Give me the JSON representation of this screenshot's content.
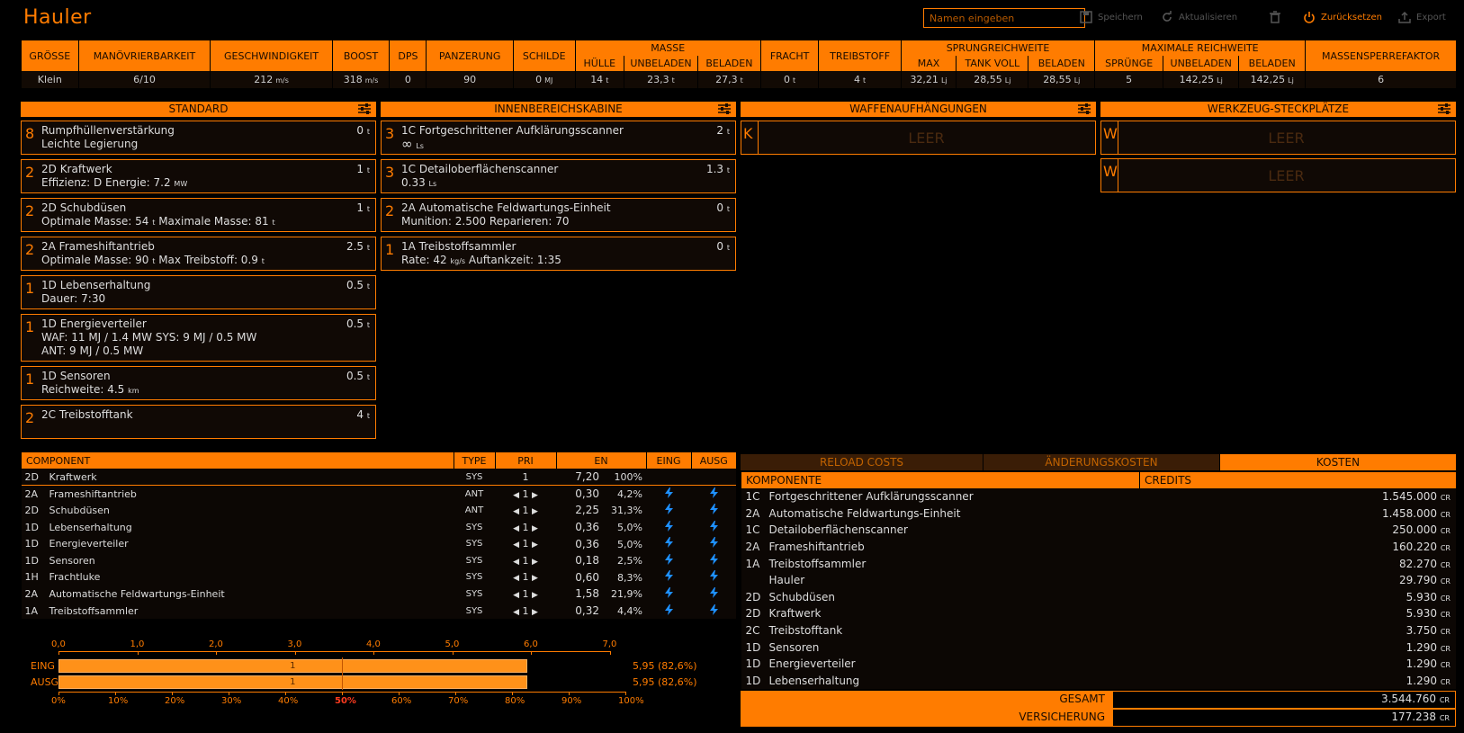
{
  "header": {
    "title": "Hauler",
    "name_placeholder": "Namen eingeben",
    "save": "Speichern",
    "update": "Aktualisieren",
    "reset": "Zurücksetzen",
    "export": "Export"
  },
  "stats": {
    "headers": {
      "size": "GRÖSSE",
      "maneuver": "MANÖVRIERBARKEIT",
      "speed": "GESCHWINDIGKEIT",
      "boost": "BOOST",
      "dps": "DPS",
      "armour": "PANZERUNG",
      "shields": "SCHILDE",
      "mass": "MASSE",
      "hull": "HÜLLE",
      "unladen": "UNBELADEN",
      "laden": "BELADEN",
      "cargo": "FRACHT",
      "fuel": "TREIBSTOFF",
      "jump": "SPRUNGREICHWEITE",
      "max": "MAX",
      "full_tank": "TANK VOLL",
      "jump_laden": "BELADEN",
      "total_range": "MAXIMALE REICHWEITE",
      "jumps": "SPRÜNGE",
      "range_unladen": "UNBELADEN",
      "range_laden": "BELADEN",
      "mass_lock": "MASSENSPERREFAKTOR"
    },
    "values": {
      "size": "Klein",
      "maneuver": "6/10",
      "speed": "212",
      "speed_unit": "m/s",
      "boost": "318",
      "boost_unit": "m/s",
      "dps": "0",
      "armour": "90",
      "shields": "0",
      "shields_unit": "MJ",
      "hull": "14",
      "unladen": "23,3",
      "laden": "27,3",
      "cargo": "0",
      "fuel": "4",
      "t": "t",
      "max": "32,21",
      "full_tank": "28,55",
      "jump_laden": "28,55",
      "ly": "Lj",
      "jumps": "5",
      "range_unladen": "142,25",
      "range_laden": "142,25",
      "mass_lock": "6"
    }
  },
  "sections": {
    "standard": "STANDARD",
    "internal": "INNENBEREICHSKABINE",
    "hardpoints": "WAFFENAUFHÄNGUNGEN",
    "utility": "WERKZEUG-STECKPLÄTZE"
  },
  "standard": [
    {
      "cls": "8",
      "name": "Rumpfhüllenverstärkung",
      "mass": "0",
      "l1": "Leichte Legierung"
    },
    {
      "cls": "2",
      "name": "2D Kraftwerk",
      "mass": "1",
      "l1": "Effizienz: D  Energie: 7.2",
      "u1": "MW"
    },
    {
      "cls": "2",
      "name": "2D Schubdüsen",
      "mass": "1",
      "l1": "Optimale Masse: 54",
      "u1": "t",
      "l1b": "  Maximale Masse: 81",
      "u1b": "t"
    },
    {
      "cls": "2",
      "name": "2A Frameshiftantrieb",
      "mass": "2.5",
      "l1": "Optimale Masse: 90",
      "u1": "t",
      "l1b": "  Max Treibstoff: 0.9",
      "u1b": "t"
    },
    {
      "cls": "1",
      "name": "1D Lebenserhaltung",
      "mass": "0.5",
      "l1": "Dauer: 7:30"
    },
    {
      "cls": "1",
      "name": "1D Energieverteiler",
      "mass": "0.5",
      "l1": "WAF: 11 MJ / 1.4 MW  SYS: 9 MJ / 0.5 MW",
      "l2": "ANT: 9 MJ / 0.5 MW"
    },
    {
      "cls": "1",
      "name": "1D Sensoren",
      "mass": "0.5",
      "l1": "Reichweite: 4.5",
      "u1": "km"
    },
    {
      "cls": "2",
      "name": "2C Treibstofftank",
      "mass": "4"
    }
  ],
  "internal": [
    {
      "cls": "3",
      "name": "1C Fortgeschrittener Aufklärungsscanner",
      "mass": "2",
      "l1": "∞",
      "u1": "Ls"
    },
    {
      "cls": "3",
      "name": "1C Detailoberflächenscanner",
      "mass": "1.3",
      "l1": "0.33",
      "u1": "Ls"
    },
    {
      "cls": "2",
      "name": "2A Automatische Feldwartungs-Einheit",
      "mass": "0",
      "l1": "Munition: 2.500  Reparieren: 70"
    },
    {
      "cls": "1",
      "name": "1A Treibstoffsammler",
      "mass": "0",
      "l1": "Rate: 42",
      "u1": "kg/s",
      "l1b": "  Auftankzeit: 1:35"
    }
  ],
  "hardpoints": [
    {
      "cls": "K",
      "label": "LEER"
    }
  ],
  "utility": [
    {
      "cls": "W",
      "label": "LEER"
    },
    {
      "cls": "W",
      "label": "LEER"
    }
  ],
  "power": {
    "headers": {
      "component": "COMPONENT",
      "type": "TYPE",
      "pri": "PRI",
      "en": "EN",
      "in": "EING",
      "out": "AUSG"
    },
    "rows": [
      {
        "id": "2D",
        "name": "Kraftwerk",
        "type": "SYS",
        "pri": "1",
        "en": "7,20",
        "pct": "100%",
        "plant": true
      },
      {
        "id": "2A",
        "name": "Frameshiftantrieb",
        "type": "ANT",
        "pri": "1",
        "en": "0,30",
        "pct": "4,2%"
      },
      {
        "id": "2D",
        "name": "Schubdüsen",
        "type": "ANT",
        "pri": "1",
        "en": "2,25",
        "pct": "31,3%"
      },
      {
        "id": "1D",
        "name": "Lebenserhaltung",
        "type": "SYS",
        "pri": "1",
        "en": "0,36",
        "pct": "5,0%"
      },
      {
        "id": "1D",
        "name": "Energieverteiler",
        "type": "SYS",
        "pri": "1",
        "en": "0,36",
        "pct": "5,0%"
      },
      {
        "id": "1D",
        "name": "Sensoren",
        "type": "SYS",
        "pri": "1",
        "en": "0,18",
        "pct": "2,5%"
      },
      {
        "id": "1H",
        "name": "Frachtluke",
        "type": "SYS",
        "pri": "1",
        "en": "0,60",
        "pct": "8,3%"
      },
      {
        "id": "2A",
        "name": "Automatische Feldwartungs-Einheit",
        "type": "SYS",
        "pri": "1",
        "en": "1,58",
        "pct": "21,9%"
      },
      {
        "id": "1A",
        "name": "Treibstoffsammler",
        "type": "SYS",
        "pri": "1",
        "en": "0,32",
        "pct": "4,4%"
      }
    ],
    "axis_top": [
      "0,0",
      "1,0",
      "2,0",
      "3,0",
      "4,0",
      "5,0",
      "6,0",
      "7,0"
    ],
    "axis_bottom": [
      "0%",
      "10%",
      "20%",
      "30%",
      "40%",
      "50%",
      "60%",
      "70%",
      "80%",
      "90%",
      "100%"
    ],
    "bars": [
      {
        "label": "EING",
        "priority": "1",
        "value": 5.95,
        "text": "5,95 (82,6%)"
      },
      {
        "label": "AUSG",
        "priority": "1",
        "value": 5.95,
        "text": "5,95 (82,6%)"
      }
    ]
  },
  "costs": {
    "tabs": [
      "RELOAD COSTS",
      "ÄNDERUNGSKOSTEN",
      "KOSTEN"
    ],
    "headers": {
      "component": "KOMPONENTE",
      "credits": "CREDITS"
    },
    "unit": "CR",
    "rows": [
      {
        "id": "1C",
        "name": "Fortgeschrittener Aufklärungsscanner",
        "value": "1.545.000"
      },
      {
        "id": "2A",
        "name": "Automatische Feldwartungs-Einheit",
        "value": "1.458.000"
      },
      {
        "id": "1C",
        "name": "Detailoberflächenscanner",
        "value": "250.000"
      },
      {
        "id": "2A",
        "name": "Frameshiftantrieb",
        "value": "160.220"
      },
      {
        "id": "1A",
        "name": "Treibstoffsammler",
        "value": "82.270"
      },
      {
        "id": "",
        "name": "Hauler",
        "value": "29.790"
      },
      {
        "id": "2D",
        "name": "Schubdüsen",
        "value": "5.930"
      },
      {
        "id": "2D",
        "name": "Kraftwerk",
        "value": "5.930"
      },
      {
        "id": "2C",
        "name": "Treibstofftank",
        "value": "3.750"
      },
      {
        "id": "1D",
        "name": "Sensoren",
        "value": "1.290"
      },
      {
        "id": "1D",
        "name": "Energieverteiler",
        "value": "1.290"
      },
      {
        "id": "1D",
        "name": "Lebenserhaltung",
        "value": "1.290"
      }
    ],
    "total_label": "GESAMT",
    "total": "3.544.760",
    "insurance_label": "VERSICHERUNG",
    "insurance": "177.238"
  }
}
